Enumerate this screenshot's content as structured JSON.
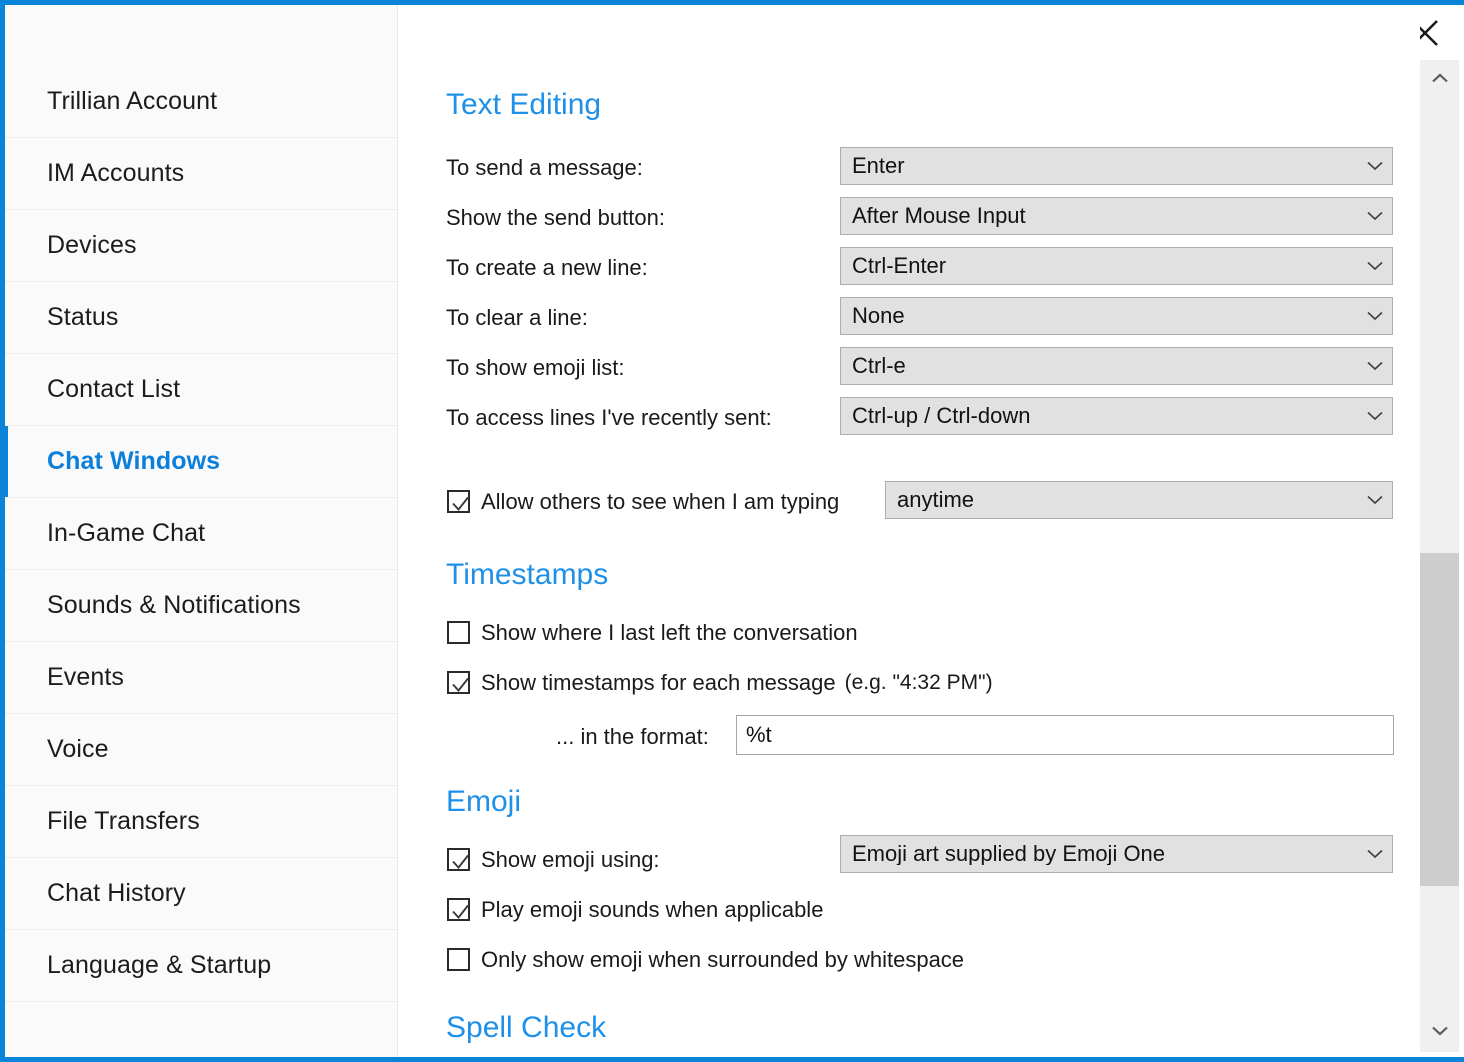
{
  "window": {
    "close_icon": "close-icon",
    "accent_color": "#0a84d8",
    "heading_color": "#1e90e8"
  },
  "sidebar": {
    "items": [
      {
        "label": "Trillian Account",
        "selected": false
      },
      {
        "label": "IM Accounts",
        "selected": false
      },
      {
        "label": "Devices",
        "selected": false
      },
      {
        "label": "Status",
        "selected": false
      },
      {
        "label": "Contact List",
        "selected": false
      },
      {
        "label": "Chat Windows",
        "selected": true
      },
      {
        "label": "In-Game Chat",
        "selected": false
      },
      {
        "label": "Sounds & Notifications",
        "selected": false
      },
      {
        "label": "Events",
        "selected": false
      },
      {
        "label": "Voice",
        "selected": false
      },
      {
        "label": "File Transfers",
        "selected": false
      },
      {
        "label": "Chat History",
        "selected": false
      },
      {
        "label": "Language & Startup",
        "selected": false
      }
    ]
  },
  "sections": {
    "text_editing": {
      "title": "Text Editing",
      "rows": [
        {
          "label": "To send a message:",
          "value": "Enter"
        },
        {
          "label": "Show the send button:",
          "value": "After Mouse Input"
        },
        {
          "label": "To create a new line:",
          "value": "Ctrl-Enter"
        },
        {
          "label": "To clear a line:",
          "value": "None"
        },
        {
          "label": "To show emoji list:",
          "value": "Ctrl-e"
        },
        {
          "label": "To access lines I've recently sent:",
          "value": "Ctrl-up / Ctrl-down"
        }
      ],
      "typing": {
        "label": "Allow others to see when I am typing",
        "checked": true,
        "value": "anytime"
      }
    },
    "timestamps": {
      "title": "Timestamps",
      "show_last_left": {
        "label": "Show where I last left the conversation",
        "checked": false
      },
      "show_timestamps": {
        "label": "Show timestamps for each message",
        "example": "(e.g. \"4:32 PM\")",
        "checked": true
      },
      "format": {
        "label": "... in the format:",
        "value": "%t"
      }
    },
    "emoji": {
      "title": "Emoji",
      "show_emoji": {
        "label": "Show emoji using:",
        "checked": true,
        "value": "Emoji art supplied by Emoji One"
      },
      "play_sounds": {
        "label": "Play emoji sounds when applicable",
        "checked": true
      },
      "whitespace_only": {
        "label": "Only show emoji when surrounded by whitespace",
        "checked": false
      }
    },
    "spell_check": {
      "title": "Spell Check"
    }
  },
  "scrollbar": {
    "up_icon": "chevron-up-icon",
    "down_icon": "chevron-down-icon",
    "thumb": "scrollbar-thumb"
  }
}
